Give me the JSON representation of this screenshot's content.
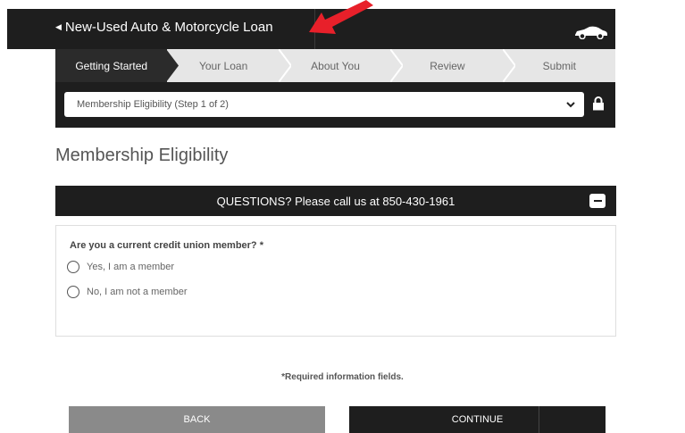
{
  "header": {
    "back_label": "New-Used Auto & Motorcycle Loan"
  },
  "steps": [
    "Getting Started",
    "Your Loan",
    "About You",
    "Review",
    "Submit"
  ],
  "active_step": "Getting Started",
  "section_select": {
    "value": "Membership Eligibility (Step 1 of 2)"
  },
  "page_title": "Membership Eligibility",
  "questions_banner": "QUESTIONS? Please call us at 850-430-1961",
  "form": {
    "question": "Are you a current credit union member?",
    "required_mark": "*",
    "options": [
      "Yes, I am a member",
      "No, I am not a member"
    ]
  },
  "required_note": "*Required information fields.",
  "buttons": {
    "back": "BACK",
    "continue": "CONTINUE"
  },
  "colors": {
    "dark_bar": "#1e1e1e",
    "step_bar": "#e6e6e6",
    "back_button": "#8a8a8a",
    "annotation_arrow": "#e8202a"
  },
  "icons": [
    "chevron-left-icon",
    "car-icon",
    "chevron-down-icon",
    "lock-icon",
    "collapse-minus-icon",
    "red-arrow-annotation"
  ]
}
